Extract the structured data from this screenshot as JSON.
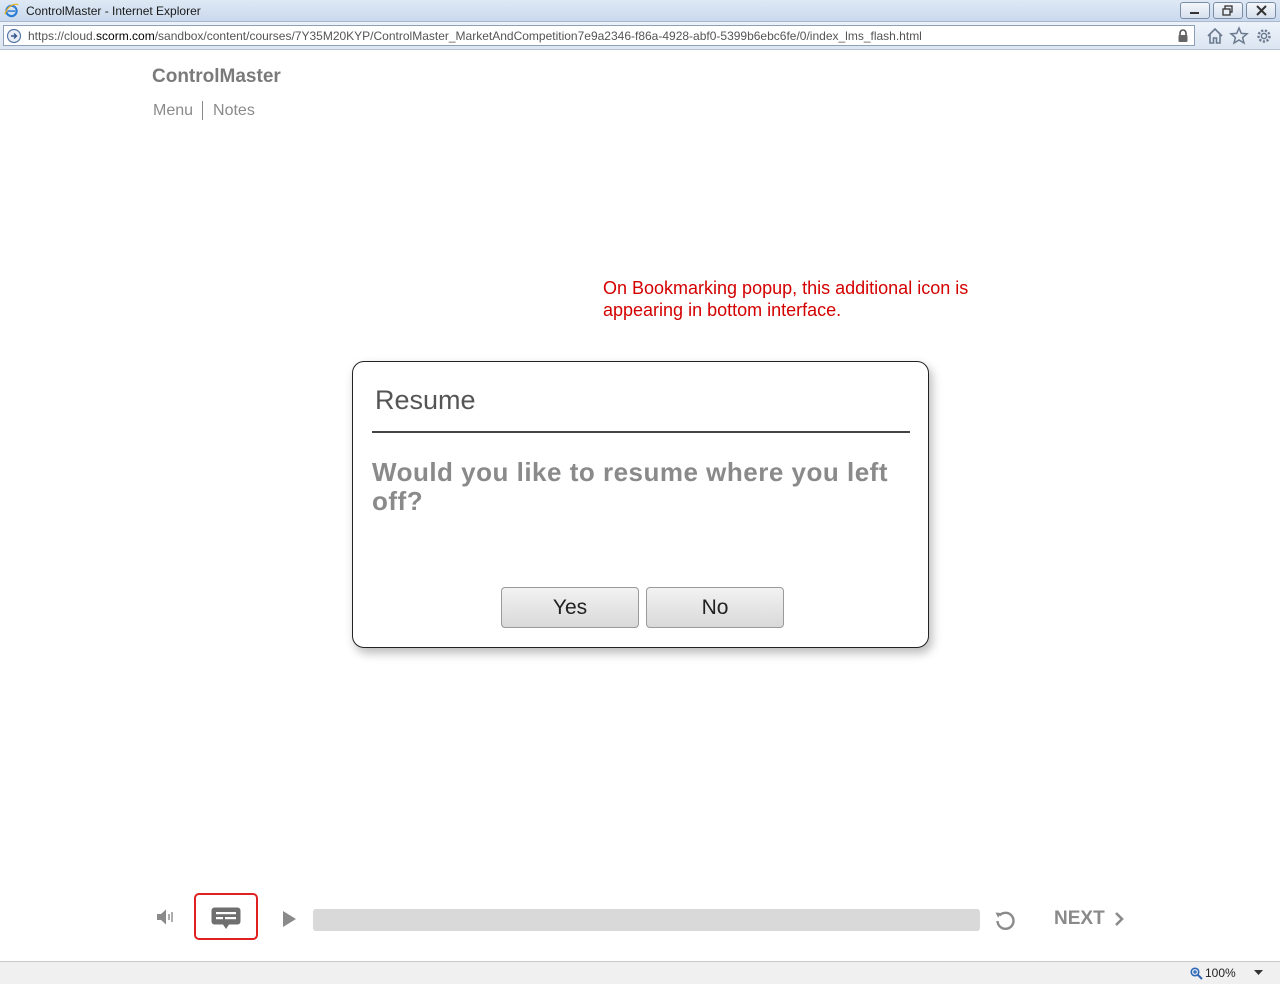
{
  "browser": {
    "title": "ControlMaster - Internet Explorer",
    "url_prefix": "https://cloud.",
    "url_host": "scorm.com",
    "url_path": "/sandbox/content/courses/7Y35M20KYP/ControlMaster_MarketAndCompetition7e9a2346-f86a-4928-abf0-5399b6ebc6fe/0/index_lms_flash.html",
    "zoom": "100%"
  },
  "course": {
    "title": "ControlMaster",
    "nav": {
      "menu": "Menu",
      "notes": "Notes"
    }
  },
  "annotation": "On Bookmarking popup, this additional icon is appearing in bottom interface.",
  "dialog": {
    "title": "Resume",
    "message": "Would you like to resume where you left off?",
    "yes": "Yes",
    "no": "No"
  },
  "player": {
    "next_label": "NEXT",
    "progress": 0,
    "icons": [
      "volume-icon",
      "closed-caption-icon",
      "play-icon",
      "replay-icon",
      "chevron-right-icon"
    ]
  },
  "colors": {
    "annotation": "#d40000",
    "highlight": "#e02020",
    "muted_text": "#8a8a8a"
  }
}
